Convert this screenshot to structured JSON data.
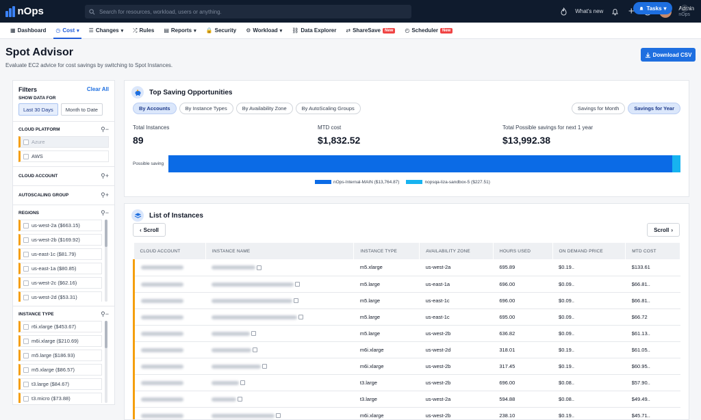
{
  "brand": {
    "name": "nOps"
  },
  "search": {
    "placeholder": "Search for resources, workload, users or anything."
  },
  "topbar": {
    "whats_new": "What's new",
    "user_name": "Admin",
    "user_org": "nOps"
  },
  "nav": {
    "items": [
      {
        "label": "Dashboard",
        "icon": "grid-icon",
        "caret": false,
        "badge": ""
      },
      {
        "label": "Cost",
        "icon": "clock-icon",
        "caret": true,
        "badge": "",
        "active": true
      },
      {
        "label": "Changes",
        "icon": "list-icon",
        "caret": true,
        "badge": ""
      },
      {
        "label": "Rules",
        "icon": "shuffle-icon",
        "caret": false,
        "badge": ""
      },
      {
        "label": "Reports",
        "icon": "document-icon",
        "caret": true,
        "badge": ""
      },
      {
        "label": "Security",
        "icon": "lock-icon",
        "caret": false,
        "badge": ""
      },
      {
        "label": "Workload",
        "icon": "gear-icon",
        "caret": true,
        "badge": ""
      },
      {
        "label": "Data Explorer",
        "icon": "link-icon",
        "caret": false,
        "badge": ""
      },
      {
        "label": "ShareSave",
        "icon": "share-icon",
        "caret": false,
        "badge": "New"
      },
      {
        "label": "Scheduler",
        "icon": "scheduler-icon",
        "caret": false,
        "badge": "New"
      }
    ],
    "tasks_label": "Tasks",
    "help_label": "?"
  },
  "page": {
    "title": "Spot Advisor",
    "subtitle": "Evaluate EC2 advice for cost savings by switching to Spot Instances.",
    "download_label": "Download CSV"
  },
  "filters": {
    "title": "Filters",
    "clear_all": "Clear All",
    "show_data_for": "SHOW DATA FOR",
    "periods": [
      "Last 30 Days",
      "Month to Date"
    ],
    "cloud_platform": {
      "label": "CLOUD PLATFORM",
      "options": [
        "Azure",
        "AWS"
      ]
    },
    "cloud_account": {
      "label": "CLOUD ACCOUNT"
    },
    "autoscaling_group": {
      "label": "AUTOSCALING GROUP"
    },
    "regions": {
      "label": "REGIONS",
      "options": [
        "us-west-2a ($663.15)",
        "us-west-2b ($169.92)",
        "us-east-1c ($81.79)",
        "us-east-1a ($80.85)",
        "us-west-2c ($62.16)",
        "us-west-2d ($53.31)"
      ]
    },
    "instance_type": {
      "label": "INSTANCE TYPE",
      "options": [
        "r6i.xlarge ($453.67)",
        "m6i.xlarge ($210.69)",
        "m5.large ($186.93)",
        "m5.xlarge ($86.57)",
        "t3.large ($84.67)",
        "t3.micro ($73.88)"
      ]
    }
  },
  "opportunities": {
    "title": "Top Saving Opportunities",
    "group_tabs": [
      "By Accounts",
      "By Instance Types",
      "By Availability Zone",
      "By AutoScaling Groups"
    ],
    "period_tabs": [
      "Savings for Month",
      "Savings for Year"
    ],
    "stats": [
      {
        "label": "Total Instances",
        "value": "89"
      },
      {
        "label": "MTD cost",
        "value": "$1,832.52"
      },
      {
        "label": "Total Possible savings for next 1 year",
        "value": "$13,992.38"
      }
    ],
    "bar_label": "Possible saving"
  },
  "chart_data": {
    "type": "bar",
    "orientation": "horizontal-stacked",
    "series": [
      {
        "name": "nOps-Internal-MAIN ($13,764.87)",
        "value": 13764.87,
        "color": "#0b6be6"
      },
      {
        "name": "nopsqa-liza-sandbox-5 ($227.51)",
        "value": 227.51,
        "color": "#17b3f0"
      }
    ]
  },
  "instances": {
    "title": "List of Instances",
    "scroll_left": "Scroll",
    "scroll_right": "Scroll",
    "columns": [
      "CLOUD ACCOUNT",
      "INSTANCE NAME",
      "INSTANCE TYPE",
      "AVAILABILITY ZONE",
      "HOURS USED",
      "ON DEMAND PRICE",
      "MTD COST"
    ],
    "rows": [
      {
        "type": "m5.xlarge",
        "zone": "us-west-2a",
        "hours": "695.89",
        "price": "$0.19..",
        "mtd": "$133.61"
      },
      {
        "type": "m5.large",
        "zone": "us-east-1a",
        "hours": "696.00",
        "price": "$0.09..",
        "mtd": "$66.81.."
      },
      {
        "type": "m5.large",
        "zone": "us-east-1c",
        "hours": "696.00",
        "price": "$0.09..",
        "mtd": "$66.81.."
      },
      {
        "type": "m5.large",
        "zone": "us-east-1c",
        "hours": "695.00",
        "price": "$0.09..",
        "mtd": "$66.72"
      },
      {
        "type": "m5.large",
        "zone": "us-west-2b",
        "hours": "636.82",
        "price": "$0.09..",
        "mtd": "$61.13.."
      },
      {
        "type": "m6i.xlarge",
        "zone": "us-west-2d",
        "hours": "318.01",
        "price": "$0.19..",
        "mtd": "$61.05.."
      },
      {
        "type": "m6i.xlarge",
        "zone": "us-west-2b",
        "hours": "317.45",
        "price": "$0.19..",
        "mtd": "$60.95.."
      },
      {
        "type": "t3.large",
        "zone": "us-west-2b",
        "hours": "696.00",
        "price": "$0.08..",
        "mtd": "$57.90.."
      },
      {
        "type": "t3.large",
        "zone": "us-west-2a",
        "hours": "594.88",
        "price": "$0.08..",
        "mtd": "$49.49.."
      },
      {
        "type": "m6i.xlarge",
        "zone": "us-west-2b",
        "hours": "238.10",
        "price": "$0.19..",
        "mtd": "$45.71.."
      }
    ]
  }
}
